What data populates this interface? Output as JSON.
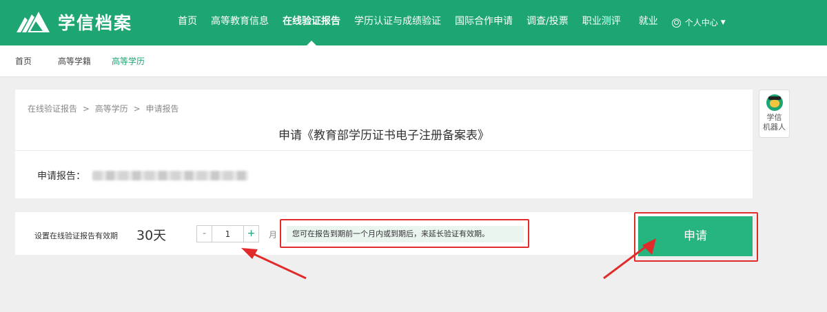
{
  "header": {
    "logo_text": "学信档案",
    "nav": [
      {
        "label": "首页"
      },
      {
        "label": "高等教育信息"
      },
      {
        "label": "在线验证报告",
        "active": true
      },
      {
        "label": "学历认证与成绩验证"
      },
      {
        "label": "国际合作申请"
      },
      {
        "label": "调查/投票"
      },
      {
        "label": "职业测评"
      },
      {
        "label": "就业"
      }
    ],
    "user_menu": "个人中心",
    "brand_color": "#1ea672"
  },
  "subnav": {
    "items": [
      "首页",
      "高等学籍",
      "高等学历"
    ],
    "current_index": 2
  },
  "card": {
    "breadcrumb": [
      "在线验证报告",
      ">",
      "高等学历",
      ">",
      "申请报告"
    ],
    "title": "申请《教育部学历证书电子注册备案表》",
    "report_label": "申请报告："
  },
  "robot": {
    "line1": "学信",
    "line2": "机器人"
  },
  "validity": {
    "label": "设置在线验证报告有效期",
    "days": "30天",
    "minus": "-",
    "months_value": "1",
    "plus": "+",
    "unit": "月",
    "tip": "您可在报告到期前一个月内或到期后，来延长验证有效期。",
    "apply_label": "申请"
  },
  "annotation_color": "#e12b2b"
}
